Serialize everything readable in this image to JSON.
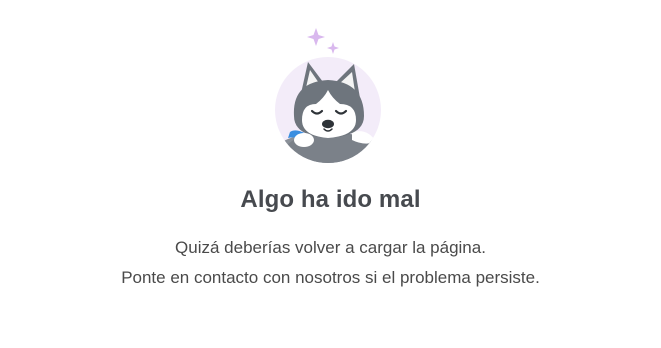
{
  "error": {
    "title": "Algo ha ido mal",
    "message_line1": "Quizá deberías volver a cargar la página.",
    "message_line2": "Ponte en contacto con nosotros si el problema persiste."
  },
  "illustration": {
    "icon": "sleeping-husky-icon",
    "colors": {
      "circle_bg": "#f3ecf9",
      "sparkle": "#d9b8ee",
      "fur_dark": "#6e757d",
      "fur_light": "#ffffff",
      "ear_inner": "#f4f4f4",
      "blanket": "#3a8ee0"
    }
  }
}
